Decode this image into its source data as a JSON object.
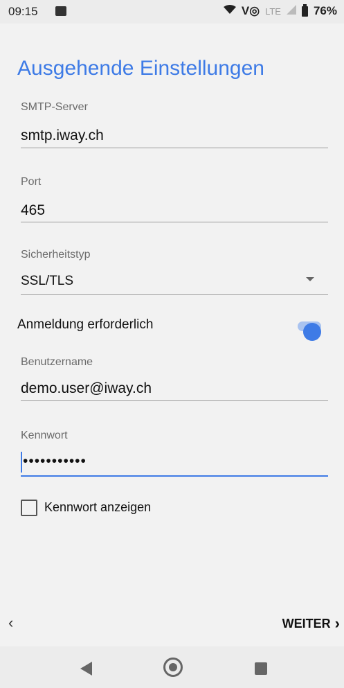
{
  "status": {
    "time": "09:15",
    "battery": "76%",
    "network": "LTE"
  },
  "title": "Ausgehende Einstellungen",
  "smtp": {
    "label": "SMTP-Server",
    "value": "smtp.iway.ch"
  },
  "port": {
    "label": "Port",
    "value": "465"
  },
  "security": {
    "label": "Sicherheitstyp",
    "value": "SSL/TLS"
  },
  "auth": {
    "label": "Anmeldung erforderlich",
    "enabled": true
  },
  "username": {
    "label": "Benutzername",
    "value": "demo.user@iway.ch"
  },
  "password": {
    "label": "Kennwort",
    "value": "•••••••••••"
  },
  "show_password": {
    "label": "Kennwort anzeigen",
    "checked": false
  },
  "nav": {
    "next_label": "WEITER"
  },
  "colors": {
    "accent": "#3e7be6",
    "toggle_track": "#a9c3f0"
  }
}
